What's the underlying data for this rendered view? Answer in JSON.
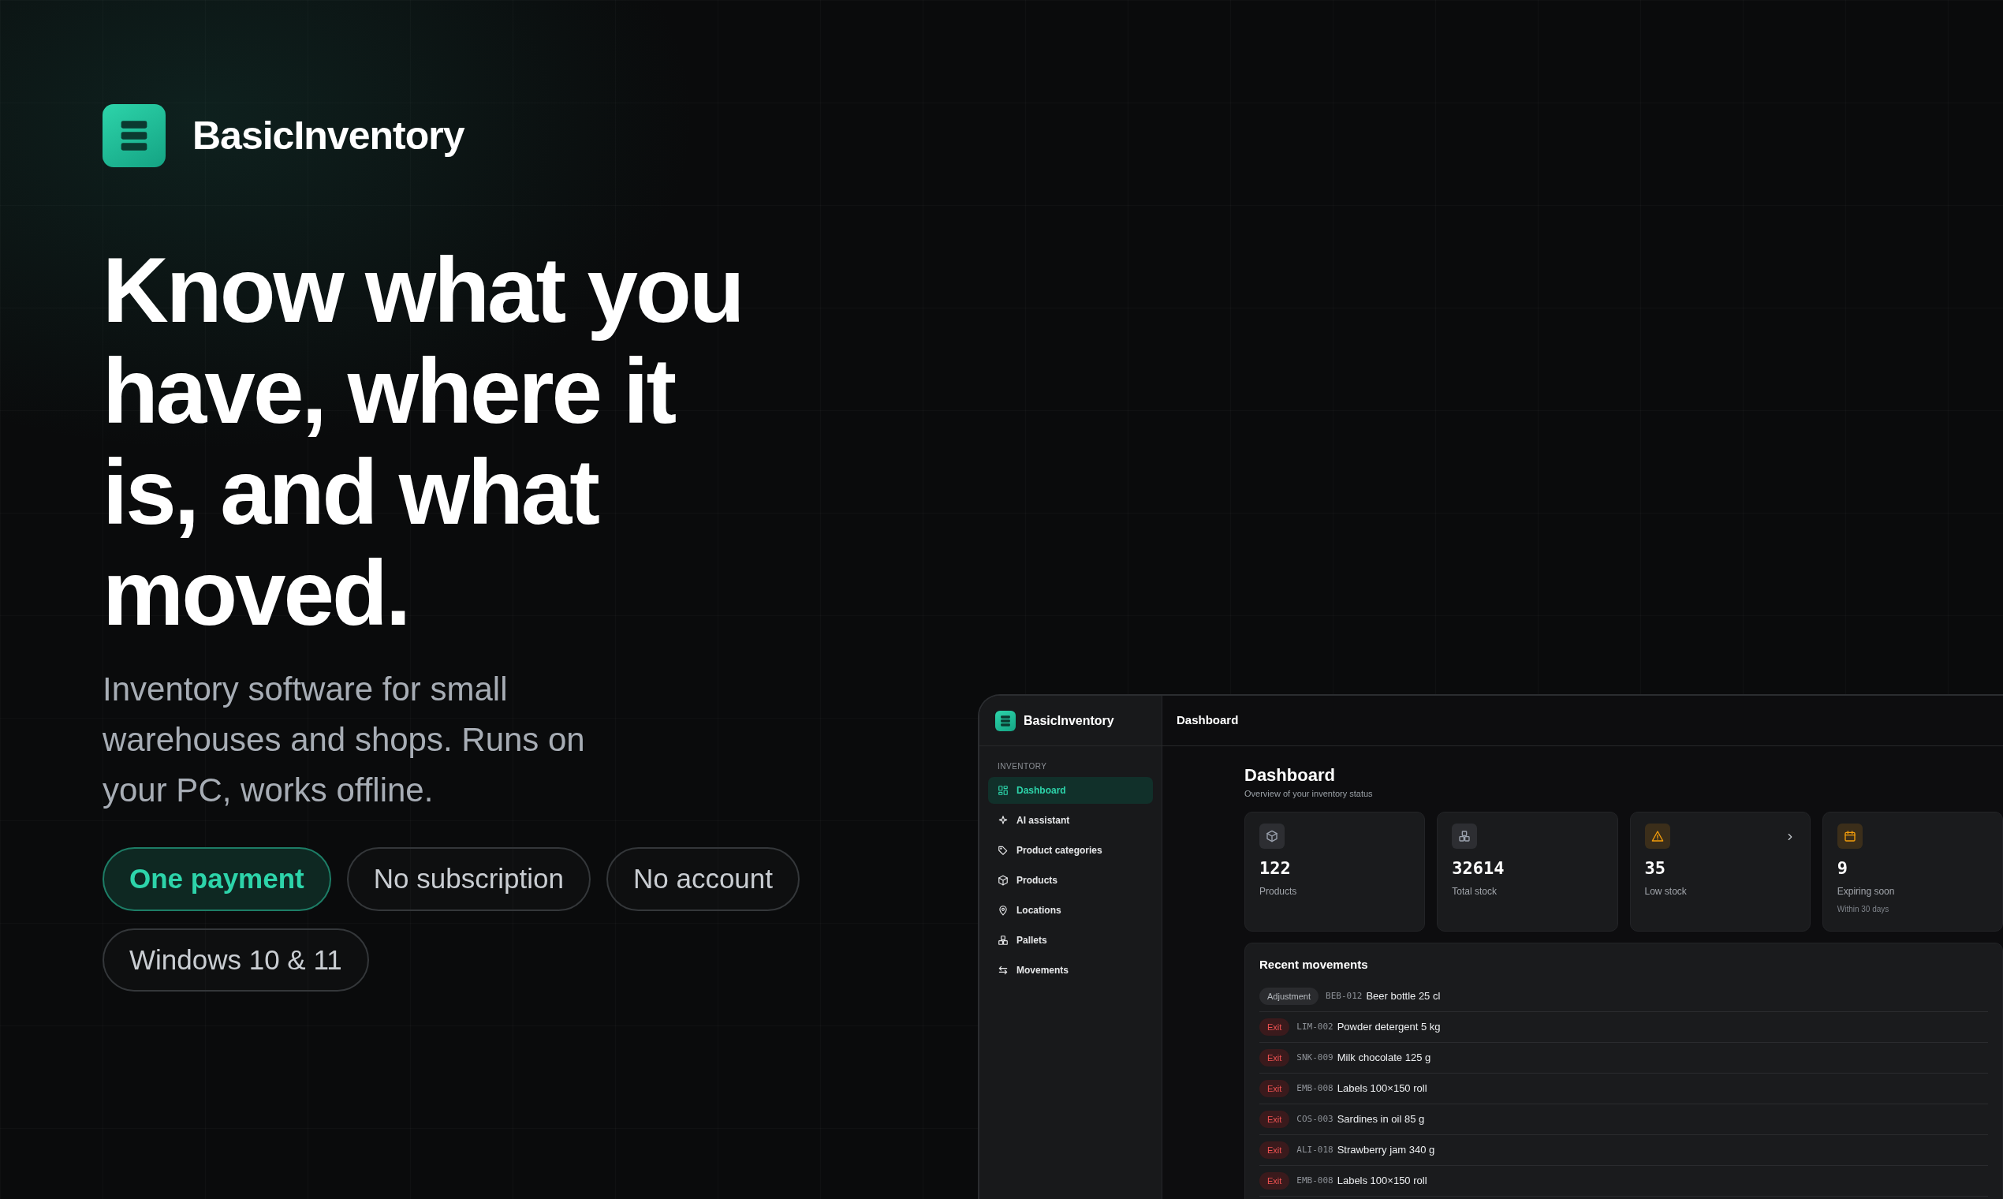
{
  "brand": {
    "name": "BasicInventory"
  },
  "hero": {
    "headline": "Know what you have, where it is, and what moved.",
    "subtitle": "Inventory software for small warehouses and shops. Runs on your PC, works offline.",
    "pills": [
      {
        "label": "One payment",
        "highlighted": true
      },
      {
        "label": "No subscription",
        "highlighted": false
      },
      {
        "label": "No account",
        "highlighted": false
      },
      {
        "label": "Windows 10 & 11",
        "highlighted": false
      }
    ]
  },
  "app": {
    "brand": "BasicInventory",
    "header_title": "Dashboard",
    "sidebar": {
      "section": "INVENTORY",
      "items": [
        {
          "label": "Dashboard",
          "selected": true
        },
        {
          "label": "AI assistant",
          "selected": false
        },
        {
          "label": "Product categories",
          "selected": false
        },
        {
          "label": "Products",
          "selected": false
        },
        {
          "label": "Locations",
          "selected": false
        },
        {
          "label": "Pallets",
          "selected": false
        },
        {
          "label": "Movements",
          "selected": false
        }
      ]
    },
    "page": {
      "title": "Dashboard",
      "subtitle": "Overview of your inventory status"
    },
    "stats": [
      {
        "value": "122",
        "label": "Products",
        "color": "#9ca3af",
        "linked": false
      },
      {
        "value": "32614",
        "label": "Total stock",
        "color": "#9ca3af",
        "linked": false
      },
      {
        "value": "35",
        "label": "Low stock",
        "color": "#f59e0b",
        "linked": true
      },
      {
        "value": "9",
        "label": "Expiring soon",
        "sublabel": "Within 30 days",
        "color": "#f59e0b",
        "linked": false
      }
    ],
    "movements": {
      "title": "Recent movements",
      "rows": [
        {
          "kind": "adjustment",
          "type": "Adjustment",
          "code": "BEB-012",
          "name": "Beer bottle 25 cl"
        },
        {
          "kind": "exit",
          "type": "Exit",
          "code": "LIM-002",
          "name": "Powder detergent 5 kg"
        },
        {
          "kind": "exit",
          "type": "Exit",
          "code": "SNK-009",
          "name": "Milk chocolate 125 g"
        },
        {
          "kind": "exit",
          "type": "Exit",
          "code": "EMB-008",
          "name": "Labels 100×150 roll"
        },
        {
          "kind": "exit",
          "type": "Exit",
          "code": "COS-003",
          "name": "Sardines in oil 85 g"
        },
        {
          "kind": "exit",
          "type": "Exit",
          "code": "ALI-018",
          "name": "Strawberry jam 340 g"
        },
        {
          "kind": "exit",
          "type": "Exit",
          "code": "EMB-008",
          "name": "Labels 100×150 roll"
        }
      ]
    }
  }
}
